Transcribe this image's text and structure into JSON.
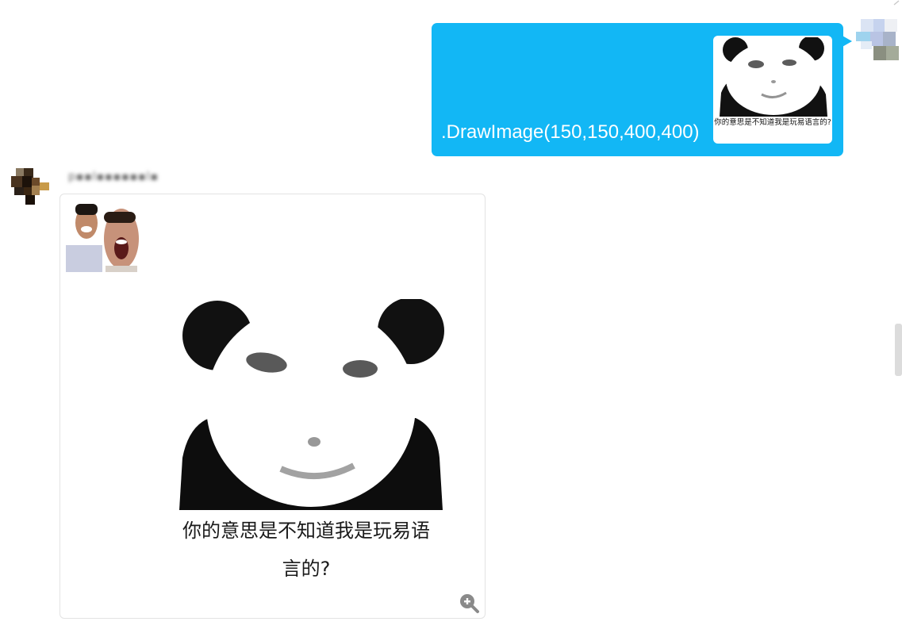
{
  "outgoing_message": {
    "text": ".DrawImage(150,150,400,400)",
    "image_caption": "你的意思是不知道我是玩易语言的?",
    "bubble_color": "#12b7f5"
  },
  "incoming_message": {
    "sender_name": "p▪▪l▪▪▪▪▪▪l▪",
    "image_caption_line1": "你的意思是不知道我是玩易语",
    "image_caption_line2": "言的?"
  },
  "icons": {
    "zoom": "zoom-in-icon"
  },
  "colors": {
    "background": "#ffffff",
    "card_border": "#e3e3e3",
    "scrollbar": "#dcdcdc"
  }
}
